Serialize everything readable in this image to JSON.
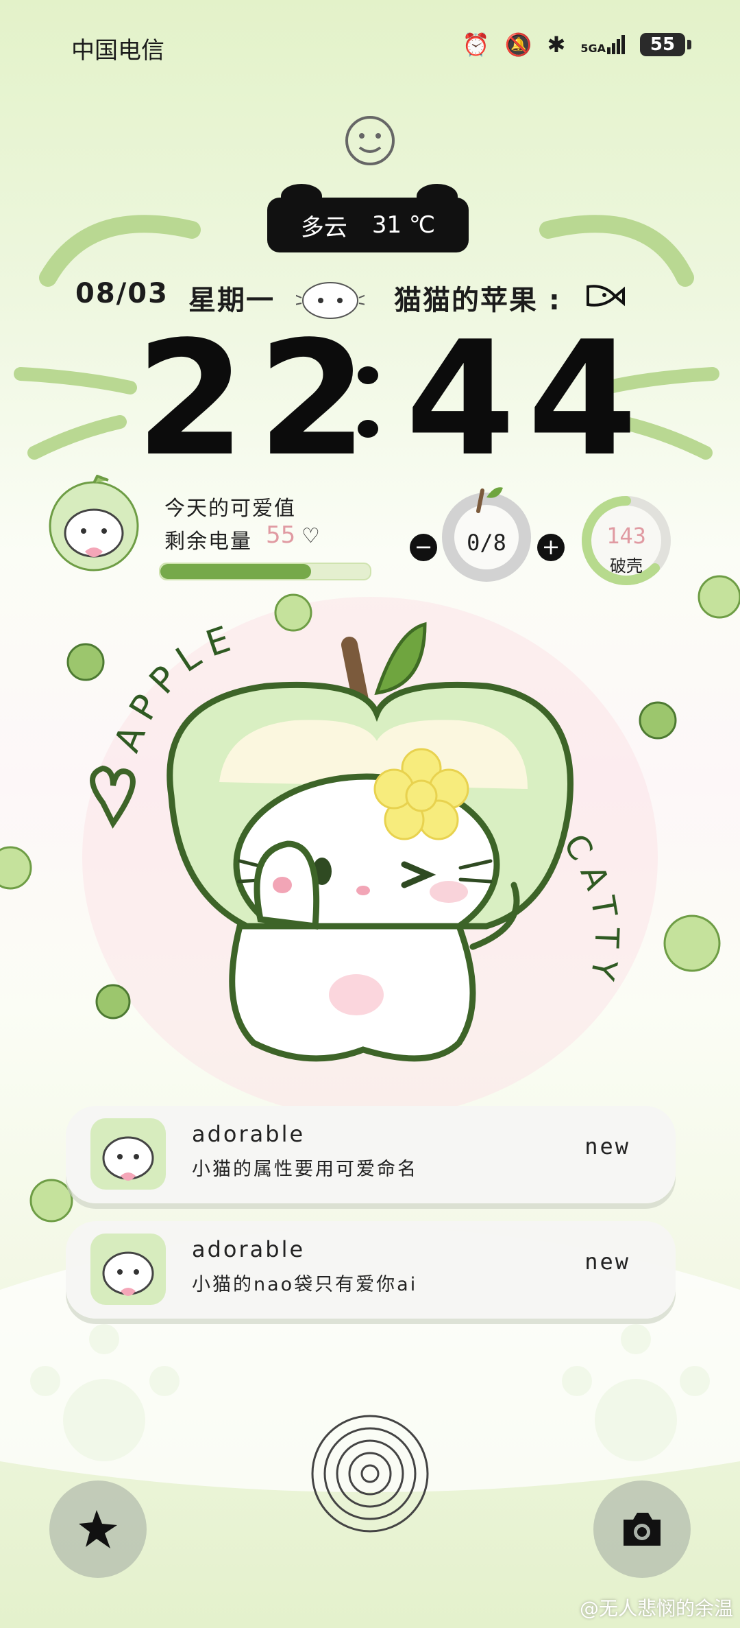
{
  "status_bar": {
    "carrier": "中国电信",
    "network": "5GA",
    "battery": "55",
    "icons": [
      "alarm-icon",
      "mute-bell-icon",
      "bluetooth-icon",
      "signal-icon",
      "battery-icon"
    ]
  },
  "weather": {
    "condition": "多云",
    "temperature": "31 ℃"
  },
  "date_row": {
    "date": "08/03",
    "weekday": "星期一",
    "caption": "猫猫的苹果 :"
  },
  "clock": {
    "hours": "22",
    "minutes": "44"
  },
  "cute_widget": {
    "line1": "今天的可爱值",
    "line2_label": "剩余电量",
    "line2_value": "55",
    "heart": "♡",
    "progress_fraction": 0.72
  },
  "apple_counter": {
    "value": "0/8",
    "minus": "−",
    "plus": "+"
  },
  "steps_ring": {
    "value": "143",
    "label": "破壳"
  },
  "hero_art": {
    "arc_left": "APPLE",
    "arc_right": "CATTY"
  },
  "notifications": [
    {
      "title": "adorable",
      "body": "小猫的属性要用可爱命名",
      "badge": "new"
    },
    {
      "title": "adorable",
      "body": "小猫的nao袋只有爱你ai",
      "badge": "new"
    }
  ],
  "bottom_actions": {
    "left_icon": "flashlight-icon",
    "right_icon": "camera-icon",
    "center_icon": "fingerprint-icon"
  },
  "watermark": "@无人悲悯的余温",
  "colors": {
    "accent_green": "#76a94a",
    "light_green": "#cfe3af",
    "pink": "#e09aa2",
    "dark": "#111111"
  }
}
